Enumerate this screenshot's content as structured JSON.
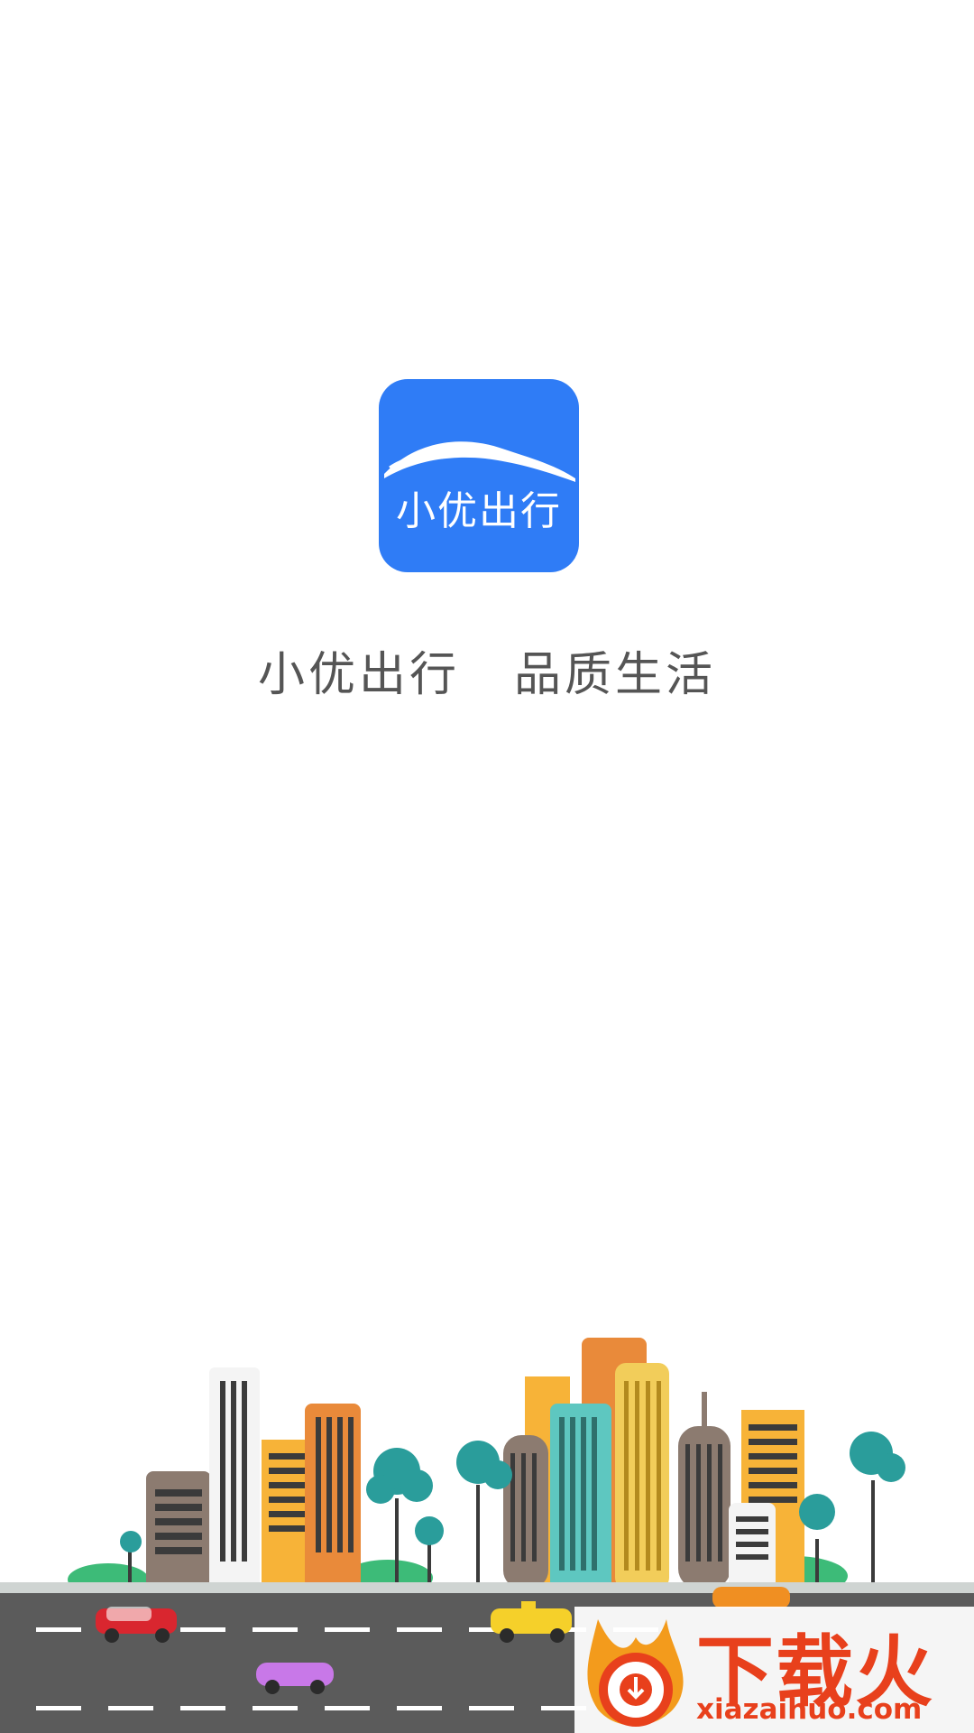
{
  "splash": {
    "app_icon_name": "小优出行",
    "slogan_left": "小优出行",
    "slogan_right": "品质生活"
  },
  "watermark": {
    "title": "下载火",
    "url": "xiazaihuo.com"
  },
  "colors": {
    "brand_blue": "#2f7cf6",
    "road": "#5b5b5b",
    "watermark_red": "#e8401c"
  }
}
